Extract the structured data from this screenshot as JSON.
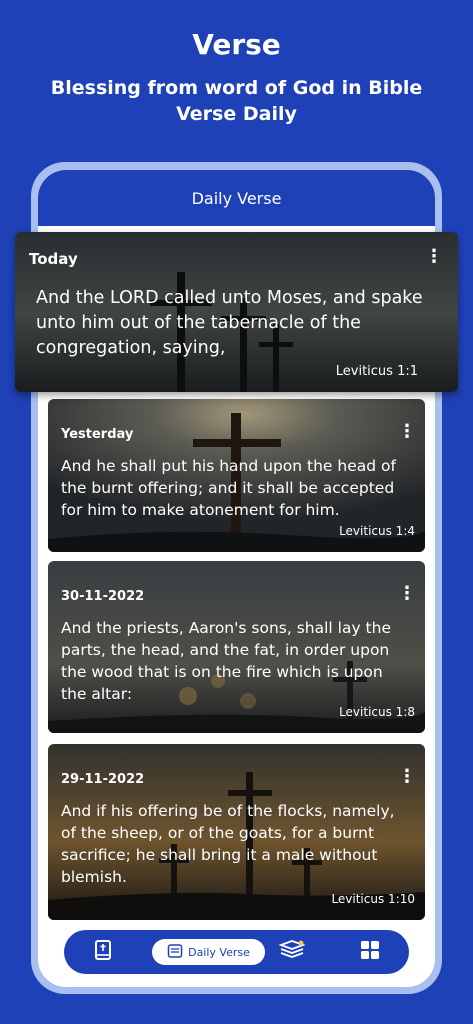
{
  "promo": {
    "title": "Verse",
    "subtitle": "Blessing from word of God in Bible Verse Daily"
  },
  "app": {
    "header_title": "Daily Verse"
  },
  "verses": [
    {
      "date": "Today",
      "text": "And the LORD called unto Moses, and spake unto him out of the tabernacle of the congregation, saying,",
      "reference": "Leviticus 1:1"
    },
    {
      "date": "Yesterday",
      "text": "And he shall put his hand upon the head of the burnt offering; and it shall be accepted for him to make atonement for him.",
      "reference": "Leviticus 1:4"
    },
    {
      "date": "30-11-2022",
      "text": "And the priests, Aaron's sons, shall lay the parts, the head, and the fat, in order upon the wood that is on the fire which is upon the altar:",
      "reference": "Leviticus 1:8"
    },
    {
      "date": "29-11-2022",
      "text": "And if his offering be of the flocks, namely, of the sheep, or of the goats, for a burnt sacrifice; he shall bring it a male without blemish.",
      "reference": "Leviticus 1:10"
    }
  ],
  "bottom_nav": {
    "items": [
      {
        "icon": "bible-book-icon"
      },
      {
        "icon": "daily-verse-icon",
        "label": "Daily Verse",
        "active": true
      },
      {
        "icon": "books-stack-icon"
      },
      {
        "icon": "grid-apps-icon"
      }
    ]
  },
  "colors": {
    "brand_blue": "#1f41b7",
    "frame_light_blue": "#a9bff0",
    "white": "#ffffff"
  }
}
